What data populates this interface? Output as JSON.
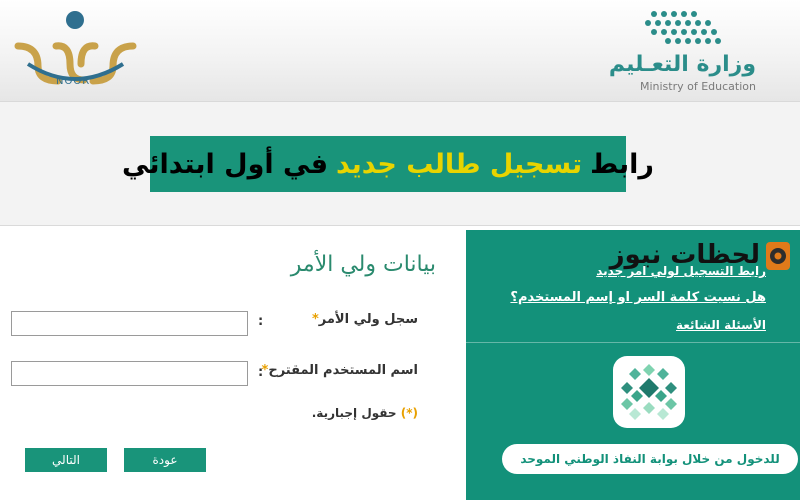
{
  "header": {
    "noor_logo_text": "NOOR",
    "ministry_ar": "وزارة التعـليم",
    "ministry_en": "Ministry of Education"
  },
  "title": {
    "part1": "رابط",
    "part2": "تسجيل طالب جديد",
    "part3": "في أول ابتدائي"
  },
  "form": {
    "section_title": "بيانات ولي الأمر",
    "fields": [
      {
        "label": "سجل ولي الأمر",
        "value": "",
        "placeholder": ""
      },
      {
        "label": "اسم المستخدم المقترح",
        "value": "",
        "placeholder": ""
      }
    ],
    "required_mark": "*",
    "colon": ":",
    "required_note_star": "(*)",
    "required_note_text": "حقول إجبارية.",
    "back_button": "عودة",
    "next_button": "التالي"
  },
  "side_panel": {
    "brand_name": "لحظات نيوز",
    "links": [
      "رابط التسجيل لولي امر جديد",
      "هل نسيت كلمة السر او إسم المستخدم؟",
      "الأسئلة الشائعة"
    ],
    "nafath_button": "للدخول من خلال بوابة النفاذ الوطني الموحد"
  },
  "colors": {
    "primary_green": "#19947a",
    "accent_yellow": "#e8d400",
    "required_orange": "#e8a000"
  }
}
